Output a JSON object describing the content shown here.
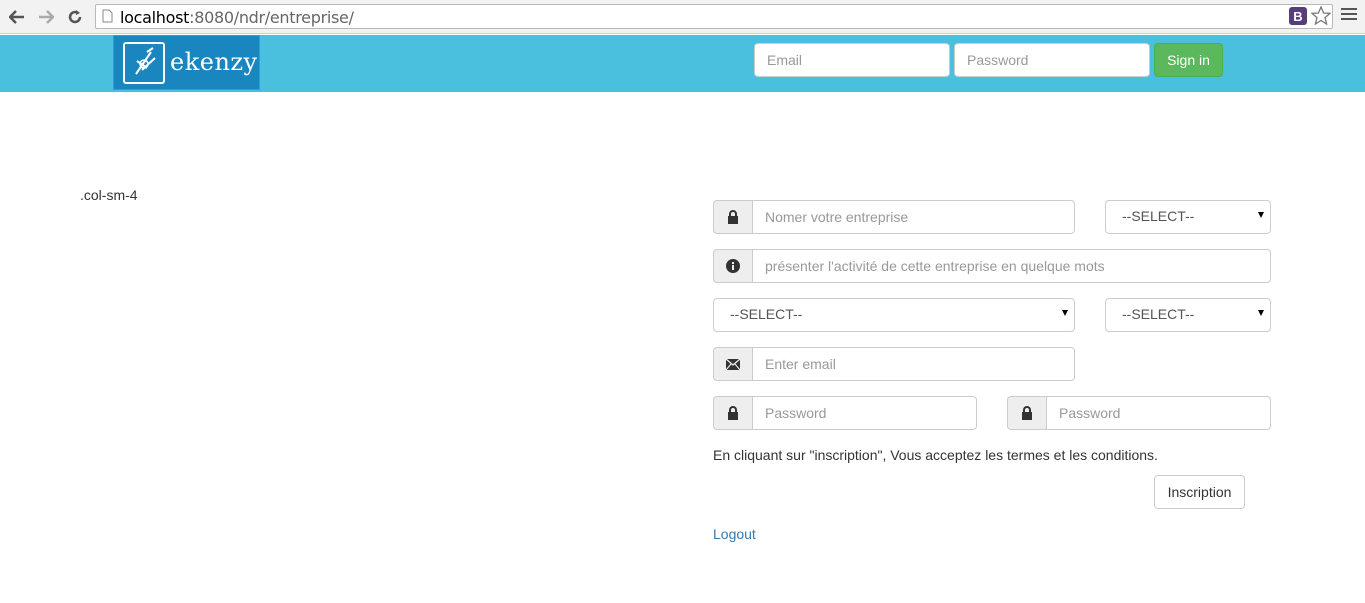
{
  "browser": {
    "url_host": "localhost",
    "url_path": ":8080/ndr/entreprise/",
    "extension_label": "B"
  },
  "navbar": {
    "logo_text": "ekenzy",
    "email_placeholder": "Email",
    "password_placeholder": "Password",
    "signin_label": "Sign in",
    "color": "#4bc0de",
    "signin_color": "#5cb85c"
  },
  "main": {
    "col_label": ".col-sm-4",
    "company_name_placeholder": "Nomer votre entreprise",
    "select_1": "--SELECT--",
    "activity_placeholder": "présenter l'activité de cette entreprise en quelque mots",
    "select_2": "--SELECT--",
    "select_3": "--SELECT--",
    "email_placeholder": "Enter email",
    "password_placeholder": "Password",
    "confirm_password_placeholder": "Password",
    "terms_text": "En cliquant sur \"inscription\", Vous acceptez les termes et les conditions.",
    "inscription_label": "Inscription",
    "logout_label": "Logout",
    "link_color": "#337ab7"
  }
}
